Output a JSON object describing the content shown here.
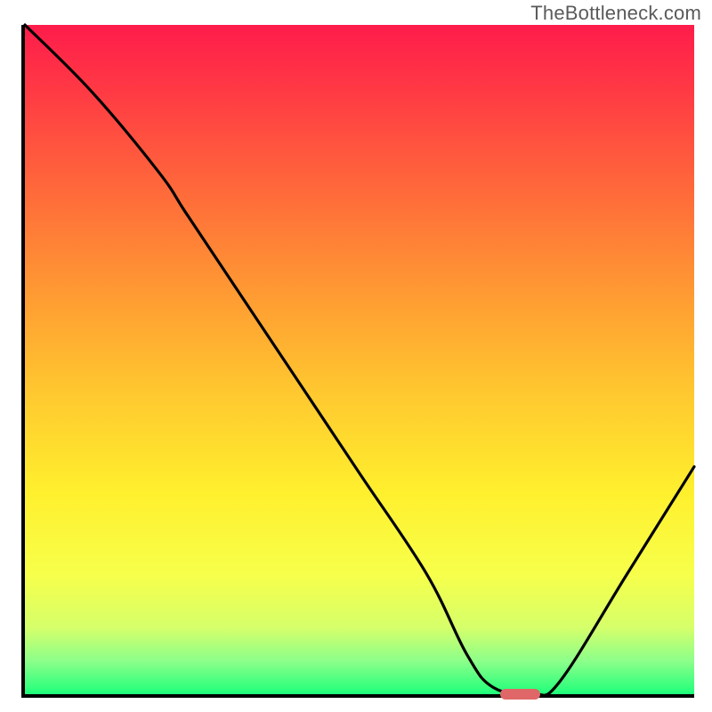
{
  "watermark": "TheBottleneck.com",
  "colors": {
    "axis": "#000000",
    "curve": "#000000",
    "marker": "#e06767",
    "gradient_stops": [
      {
        "offset": 0.0,
        "color": "#ff1c4b"
      },
      {
        "offset": 0.1,
        "color": "#ff3a44"
      },
      {
        "offset": 0.25,
        "color": "#ff6a3a"
      },
      {
        "offset": 0.4,
        "color": "#ff9a33"
      },
      {
        "offset": 0.55,
        "color": "#ffc82f"
      },
      {
        "offset": 0.7,
        "color": "#fff02e"
      },
      {
        "offset": 0.82,
        "color": "#f7ff4a"
      },
      {
        "offset": 0.9,
        "color": "#d6ff6a"
      },
      {
        "offset": 0.95,
        "color": "#8dff8a"
      },
      {
        "offset": 1.0,
        "color": "#1fff7a"
      }
    ]
  },
  "chart_data": {
    "type": "line",
    "title": "",
    "xlabel": "",
    "ylabel": "",
    "xlim": [
      0,
      100
    ],
    "ylim": [
      0,
      100
    ],
    "grid": false,
    "series": [
      {
        "name": "bottleneck-curve",
        "x": [
          0,
          10,
          20,
          24,
          30,
          40,
          50,
          60,
          66,
          70,
          76,
          80,
          90,
          100
        ],
        "y": [
          100,
          90,
          78,
          72,
          63,
          48,
          33,
          18,
          6,
          1,
          0,
          2,
          18,
          34
        ]
      }
    ],
    "optimum_marker": {
      "x": 74,
      "width": 6,
      "y": 0
    }
  }
}
